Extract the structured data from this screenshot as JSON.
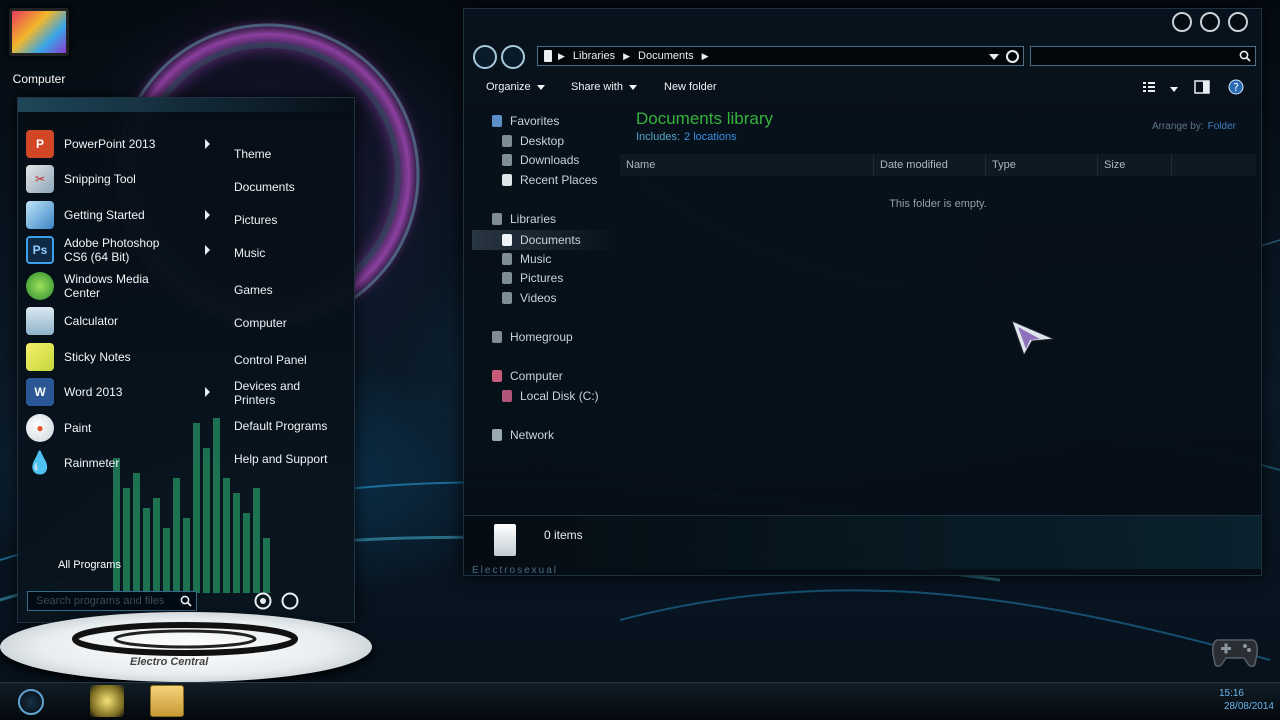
{
  "desktop": {
    "icons": [
      {
        "label": "Computer"
      }
    ]
  },
  "start_menu": {
    "pinned": [
      {
        "label": "PowerPoint 2013",
        "icon": "powerpoint-icon",
        "has_submenu": true
      },
      {
        "label": "Snipping Tool",
        "icon": "scissors-icon",
        "has_submenu": false
      },
      {
        "label": "Getting Started",
        "icon": "getting-started-icon",
        "has_submenu": true
      },
      {
        "label": "Adobe Photoshop CS6 (64 Bit)",
        "icon": "photoshop-icon",
        "has_submenu": true
      },
      {
        "label": "Windows Media Center",
        "icon": "media-center-icon",
        "has_submenu": false
      },
      {
        "label": "Calculator",
        "icon": "calculator-icon",
        "has_submenu": false
      },
      {
        "label": "Sticky Notes",
        "icon": "sticky-notes-icon",
        "has_submenu": false
      },
      {
        "label": "Word 2013",
        "icon": "word-icon",
        "has_submenu": true
      },
      {
        "label": "Paint",
        "icon": "paint-icon",
        "has_submenu": false
      },
      {
        "label": "Rainmeter",
        "icon": "rainmeter-icon",
        "has_submenu": false
      }
    ],
    "right_column": [
      {
        "label": "Theme"
      },
      {
        "label": "Documents"
      },
      {
        "label": "Pictures"
      },
      {
        "label": "Music"
      },
      {
        "label": "Games"
      },
      {
        "label": "Computer"
      },
      {
        "label": "Control Panel"
      },
      {
        "label": "Devices and Printers"
      },
      {
        "label": "Default Programs"
      },
      {
        "label": "Help and Support"
      }
    ],
    "all_programs": "All Programs",
    "search_placeholder": "Search programs and files",
    "brand": "Electro Central"
  },
  "explorer": {
    "breadcrumb": [
      "Libraries",
      "Documents"
    ],
    "toolbar": {
      "organize": "Organize",
      "share_with": "Share with",
      "new_folder": "New folder"
    },
    "nav_groups": [
      {
        "label": "Favorites",
        "children": [
          "Desktop",
          "Downloads",
          "Recent Places"
        ]
      },
      {
        "label": "Libraries",
        "children": [
          "Documents",
          "Music",
          "Pictures",
          "Videos"
        ]
      },
      {
        "label": "Homegroup",
        "children": []
      },
      {
        "label": "Computer",
        "children": [
          "Local Disk (C:)"
        ]
      },
      {
        "label": "Network",
        "children": []
      }
    ],
    "selected_nav": "Documents",
    "library_title": "Documents library",
    "includes_label": "Includes:",
    "includes_link": "2 locations",
    "arrange_by_label": "Arrange by:",
    "arrange_by_value": "Folder",
    "columns": [
      "Name",
      "Date modified",
      "Type",
      "Size"
    ],
    "empty_message": "This folder is empty.",
    "item_count": "0 items",
    "watermark": "Electrosexual"
  },
  "taskbar": {
    "time": "15:16",
    "date": "28/08/2014"
  },
  "colors": {
    "library_title": "#36b23b",
    "link": "#3b8fe3",
    "accent": "#5fa3d2"
  }
}
